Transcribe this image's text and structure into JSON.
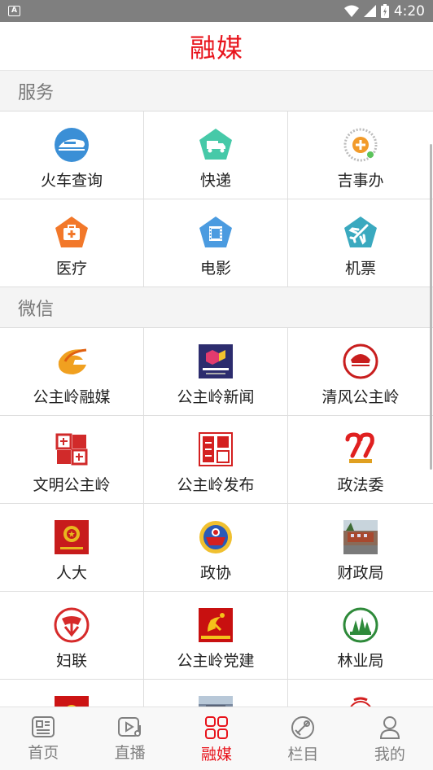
{
  "status_bar": {
    "notification": "A",
    "time": "4:20"
  },
  "header": {
    "title": "融媒"
  },
  "services": {
    "title": "服务",
    "items": [
      {
        "label": "火车查询",
        "icon": "train-icon"
      },
      {
        "label": "快递",
        "icon": "delivery-truck-icon"
      },
      {
        "label": "吉事办",
        "icon": "jishiban-qr-icon"
      },
      {
        "label": "医疗",
        "icon": "medical-kit-icon"
      },
      {
        "label": "电影",
        "icon": "film-icon"
      },
      {
        "label": "机票",
        "icon": "airplane-icon"
      }
    ]
  },
  "wechat": {
    "title": "微信",
    "items": [
      {
        "label": "公主岭融媒",
        "icon": "gzl-media-logo-icon"
      },
      {
        "label": "公主岭新闻",
        "icon": "gzl-news-logo-icon"
      },
      {
        "label": "清风公主岭",
        "icon": "qingfeng-logo-icon"
      },
      {
        "label": "文明公主岭",
        "icon": "wenming-seal-icon"
      },
      {
        "label": "公主岭发布",
        "icon": "gzl-release-seal-icon"
      },
      {
        "label": "政法委",
        "icon": "zhengfawei-logo-icon"
      },
      {
        "label": "人大",
        "icon": "renda-emblem-icon"
      },
      {
        "label": "政协",
        "icon": "zhengxie-emblem-icon"
      },
      {
        "label": "财政局",
        "icon": "finance-bureau-photo-icon"
      },
      {
        "label": "妇联",
        "icon": "women-federation-icon"
      },
      {
        "label": "公主岭党建",
        "icon": "party-building-icon"
      },
      {
        "label": "林业局",
        "icon": "forestry-bureau-icon"
      },
      {
        "label": "",
        "icon": "partial-red-logo-icon"
      },
      {
        "label": "",
        "icon": "partial-photo-icon"
      },
      {
        "label": "",
        "icon": "partial-logo-icon"
      }
    ]
  },
  "bottom_nav": [
    {
      "label": "首页",
      "icon": "news-icon",
      "active": false
    },
    {
      "label": "直播",
      "icon": "live-icon",
      "active": false
    },
    {
      "label": "融媒",
      "icon": "grid-icon",
      "active": true
    },
    {
      "label": "栏目",
      "icon": "columns-icon",
      "active": false
    },
    {
      "label": "我的",
      "icon": "user-icon",
      "active": false
    }
  ],
  "colors": {
    "accent": "#e8141c",
    "inactive": "#808080"
  }
}
